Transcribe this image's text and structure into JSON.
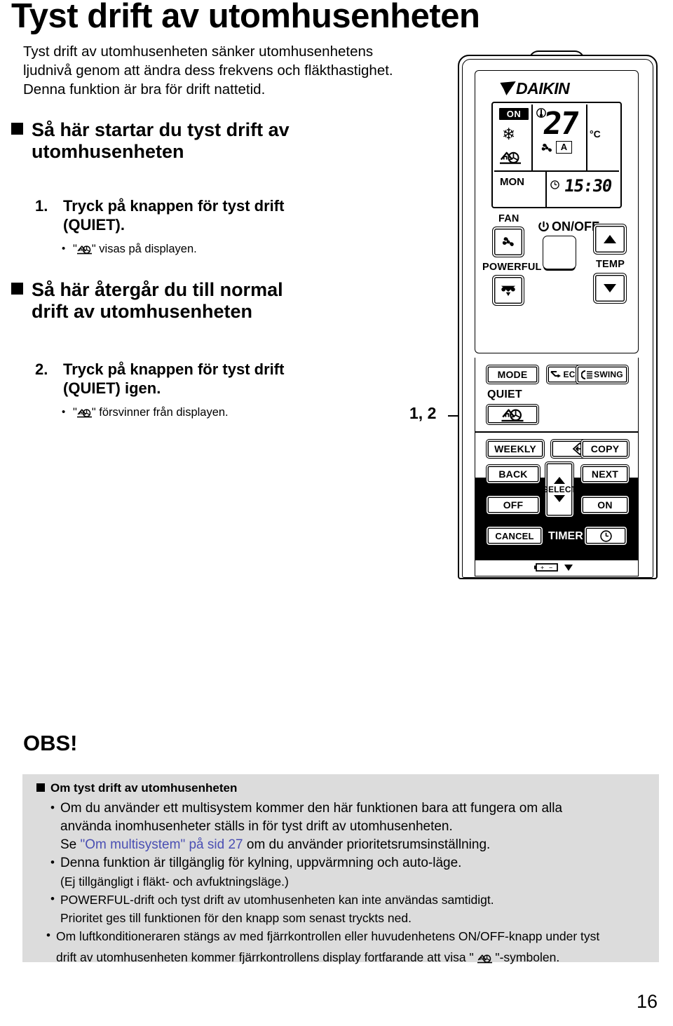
{
  "page": {
    "title": "Tyst drift av utomhusenheten",
    "number": "16",
    "intro": [
      "Tyst drift av utomhusenheten sänker utomhusenhetens",
      "ljudnivå genom att ändra dess frekvens och fläkthastighet.",
      "Denna funktion är bra för drift nattetid."
    ]
  },
  "sections": [
    {
      "heading_line1": "Så här startar du tyst drift av",
      "heading_line2": "utomhusenheten",
      "step_number": "1.",
      "step_line1": "Tryck på knappen för tyst drift",
      "step_line2": "(QUIET).",
      "bullet_prefix": "\"",
      "bullet_suffix": "\" visas på displayen."
    },
    {
      "heading_line1": "Så här återgår du till normal",
      "heading_line2": "drift av utomhusenheten",
      "step_number": "2.",
      "step_line1": "Tryck på knappen för tyst drift",
      "step_line2": "(QUIET) igen.",
      "bullet_prefix": "\"",
      "bullet_suffix": "\" försvinner från displayen."
    }
  ],
  "callout": {
    "label": "1, 2"
  },
  "remote": {
    "brand": "DAIKIN",
    "display": {
      "on_badge": "ON",
      "mode_icon": "snowflake-icon",
      "quiet_icon": "quiet-house-icon",
      "weekday": "MON",
      "temperature": "27",
      "temperature_unit": "°C",
      "fan_icon": "fan-icon",
      "fan_mode": "A",
      "clock_icon": "clock-icon",
      "clock": "15:30"
    },
    "buttons": {
      "fan_label": "FAN",
      "powerful_label": "POWERFUL",
      "onoff_label": "ON/OFF",
      "temp_label": "TEMP",
      "temp_up_icon": "triangle-up-icon",
      "temp_down_icon": "triangle-down-icon",
      "mode": "MODE",
      "econo": "ECONO",
      "swing": "SWING",
      "quiet_label": "QUIET",
      "quiet_icon": "quiet-house-icon",
      "weekly": "WEEKLY",
      "diamond_icon": "diamond-arrow-icon",
      "copy": "COPY",
      "back": "BACK",
      "select_label": "SELECT",
      "select_up_icon": "triangle-up-icon",
      "select_down_icon": "triangle-down-icon",
      "next": "NEXT",
      "off": "OFF",
      "on": "ON",
      "cancel": "CANCEL",
      "timer_label": "TIMER",
      "timer_icon": "clock-icon",
      "battery_icon": "battery-icon"
    }
  },
  "notes": {
    "title": "OBS!",
    "heading": "Om tyst drift av utomhusenheten",
    "items": [
      {
        "lines": [
          "Om du använder ett multisystem kommer den här funktionen bara att fungera om alla",
          "använda inomhusenheter ställs in för tyst drift av utomhusenheten."
        ],
        "link_line": {
          "before": "Se ",
          "link": "\"Om multisystem\" på sid 27",
          "after": " om du använder prioritetsrumsinställning."
        }
      },
      {
        "lines": [
          "Denna funktion är tillgänglig för kylning, uppvärmning och auto-läge.",
          "(Ej tillgängligt i fläkt- och avfuktningsläge.)"
        ]
      },
      {
        "lines": [
          "POWERFUL-drift och tyst drift av utomhusenheten kan inte användas samtidigt.",
          "Prioritet ges till funktionen för den knapp som senast tryckts ned."
        ]
      },
      {
        "lines": [
          "Om luftkonditioneraren stängs av med fjärrkontrollen eller huvudenhetens ON/OFF-knapp under tyst"
        ],
        "icon_line": {
          "before": "drift av utomhusenheten kommer fjärrkontrollens display fortfarande att visa \" ",
          "after": " \"-symbolen."
        }
      }
    ]
  },
  "colors": {
    "note_background": "#dcdcdc",
    "link": "#4a4fb3",
    "ink": "#000000"
  }
}
